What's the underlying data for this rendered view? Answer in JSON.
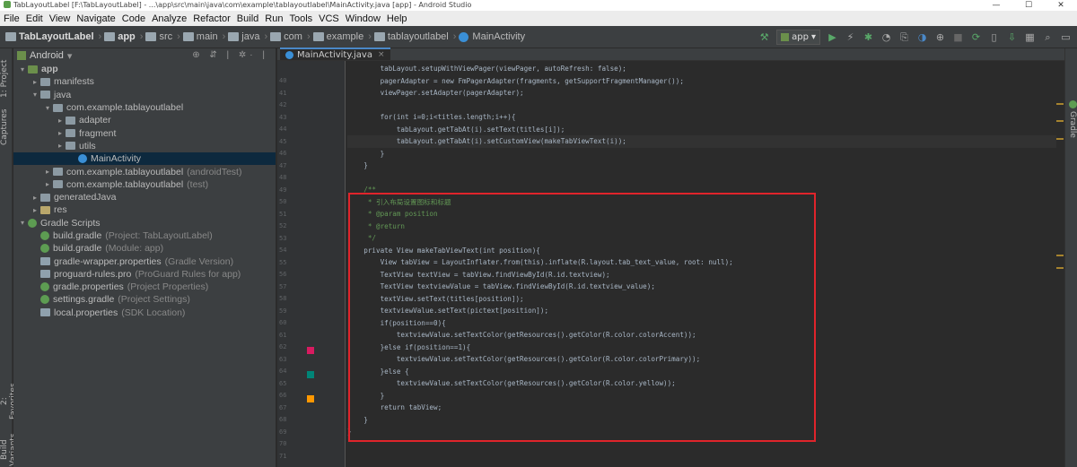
{
  "window": {
    "title": "TabLayoutLabel [F:\\TabLayoutLabel] - ...\\app\\src\\main\\java\\com\\example\\tablayoutlabel\\MainActivity.java [app] - Android Studio",
    "controls": [
      "—",
      "☐",
      "✕"
    ]
  },
  "menu": [
    "File",
    "Edit",
    "View",
    "Navigate",
    "Code",
    "Analyze",
    "Refactor",
    "Build",
    "Run",
    "Tools",
    "VCS",
    "Window",
    "Help"
  ],
  "breadcrumbs": [
    "TabLayoutLabel",
    "app",
    "src",
    "main",
    "java",
    "com",
    "example",
    "tablayoutlabel",
    "MainActivity"
  ],
  "toolbar": {
    "run_config": "app"
  },
  "side_tabs": {
    "project": "1: Project",
    "captures": "Captures",
    "favorites": "2: Favorites",
    "variants": "Build Variants",
    "gradle": "Gradle"
  },
  "project": {
    "view_label": "Android",
    "tree": [
      {
        "label": "app",
        "extra": "",
        "level": 0,
        "icon": "app",
        "arrow": "▾",
        "bold": true
      },
      {
        "label": "manifests",
        "extra": "",
        "level": 1,
        "icon": "folder",
        "arrow": "▸"
      },
      {
        "label": "java",
        "extra": "",
        "level": 1,
        "icon": "folder",
        "arrow": "▾"
      },
      {
        "label": "com.example.tablayoutlabel",
        "extra": "",
        "level": 2,
        "icon": "pkg",
        "arrow": "▾"
      },
      {
        "label": "adapter",
        "extra": "",
        "level": 3,
        "icon": "pkg",
        "arrow": "▸"
      },
      {
        "label": "fragment",
        "extra": "",
        "level": 3,
        "icon": "pkg",
        "arrow": "▸"
      },
      {
        "label": "utils",
        "extra": "",
        "level": 3,
        "icon": "pkg",
        "arrow": "▸"
      },
      {
        "label": "MainActivity",
        "extra": "",
        "level": 4,
        "icon": "cls",
        "arrow": "",
        "selected": true
      },
      {
        "label": "com.example.tablayoutlabel",
        "extra": "(androidTest)",
        "level": 2,
        "icon": "pkg",
        "arrow": "▸"
      },
      {
        "label": "com.example.tablayoutlabel",
        "extra": "(test)",
        "level": 2,
        "icon": "pkg",
        "arrow": "▸"
      },
      {
        "label": "generatedJava",
        "extra": "",
        "level": 1,
        "icon": "folder",
        "arrow": "▸"
      },
      {
        "label": "res",
        "extra": "",
        "level": 1,
        "icon": "res",
        "arrow": "▸"
      },
      {
        "label": "Gradle Scripts",
        "extra": "",
        "level": 0,
        "icon": "gradle",
        "arrow": "▾"
      },
      {
        "label": "build.gradle",
        "extra": "(Project: TabLayoutLabel)",
        "level": 1,
        "icon": "gradle",
        "arrow": ""
      },
      {
        "label": "build.gradle",
        "extra": "(Module: app)",
        "level": 1,
        "icon": "gradle",
        "arrow": ""
      },
      {
        "label": "gradle-wrapper.properties",
        "extra": "(Gradle Version)",
        "level": 1,
        "icon": "prop",
        "arrow": ""
      },
      {
        "label": "proguard-rules.pro",
        "extra": "(ProGuard Rules for app)",
        "level": 1,
        "icon": "prop",
        "arrow": ""
      },
      {
        "label": "gradle.properties",
        "extra": "(Project Properties)",
        "level": 1,
        "icon": "gradle",
        "arrow": ""
      },
      {
        "label": "settings.gradle",
        "extra": "(Project Settings)",
        "level": 1,
        "icon": "gradle",
        "arrow": ""
      },
      {
        "label": "local.properties",
        "extra": "(SDK Location)",
        "level": 1,
        "icon": "prop",
        "arrow": ""
      }
    ]
  },
  "editor": {
    "tab": "MainActivity.java",
    "line_numbers": [
      "40",
      "41",
      "42",
      "43",
      "44",
      "45",
      "46",
      "47",
      "48",
      "49",
      "50",
      "51",
      "52",
      "53",
      "54",
      "55",
      "56",
      "57",
      "58",
      "59",
      "60",
      "61",
      "62",
      "63",
      "64",
      "65",
      "66",
      "67",
      "68",
      "69",
      "70",
      "71"
    ],
    "lines": [
      "        tabLayout.setupWithViewPager(viewPager, autoRefresh: false);",
      "        pagerAdapter = new FmPagerAdapter(fragments, getSupportFragmentManager());",
      "        viewPager.setAdapter(pagerAdapter);",
      "",
      "        for(int i=0;i<titles.length;i++){",
      "            tabLayout.getTabAt(i).setText(titles[i]);",
      "            tabLayout.getTabAt(i).setCustomView(makeTabViewText(i));",
      "        }",
      "    }",
      "",
      "    /**",
      "     * 引入布局设置图标和标题",
      "     * @param position",
      "     * @return",
      "     */",
      "    private View makeTabViewText(int position){",
      "        View tabView = LayoutInflater.from(this).inflate(R.layout.tab_text_value, root: null);",
      "        TextView textView = tabView.findViewById(R.id.textview);",
      "        TextView textviewValue = tabView.findViewById(R.id.textview_value);",
      "        textView.setText(titles[position]);",
      "        textviewValue.setText(pictext[position]);",
      "        if(position==0){",
      "            textviewValue.setTextColor(getResources().getColor(R.color.colorAccent));",
      "        }else if(position==1){",
      "            textviewValue.setTextColor(getResources().getColor(R.color.colorPrimary));",
      "        }else {",
      "            textviewValue.setTextColor(getResources().getColor(R.color.yellow));",
      "        }",
      "        return tabView;",
      "    }",
      "}",
      ""
    ],
    "swatch_colors": [
      "#d81b60",
      "#008577",
      "#ff9800"
    ]
  }
}
